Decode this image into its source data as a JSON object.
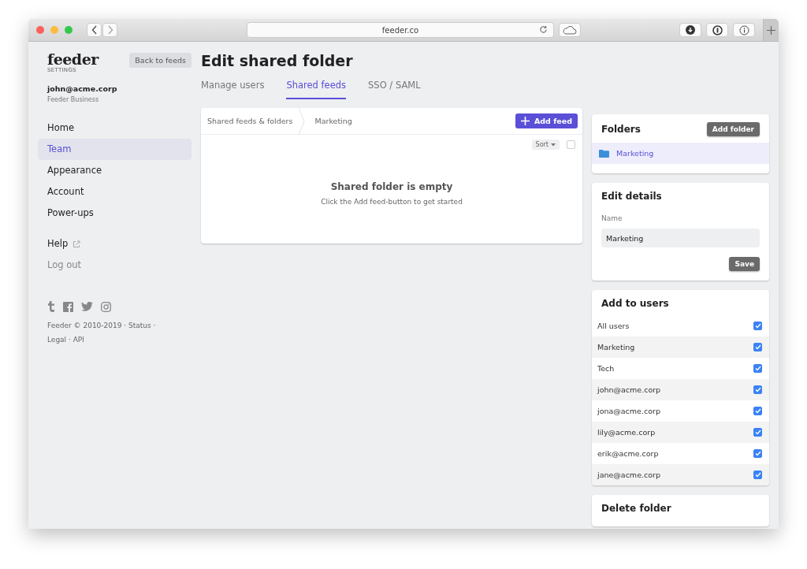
{
  "browser": {
    "url": "feeder.co"
  },
  "sidebar": {
    "logo": "feeder",
    "logo_sub": "SETTINGS",
    "back_button": "Back to feeds",
    "user_email": "john@acme.corp",
    "plan": "Feeder Business",
    "nav": [
      {
        "label": "Home",
        "selected": false
      },
      {
        "label": "Team",
        "selected": true
      },
      {
        "label": "Appearance",
        "selected": false
      },
      {
        "label": "Account",
        "selected": false
      },
      {
        "label": "Power-ups",
        "selected": false
      }
    ],
    "help": "Help",
    "logout": "Log out",
    "footer": "Feeder © 2010-2019 · Status · Legal · API"
  },
  "page_title": "Edit shared folder",
  "tabs": [
    {
      "label": "Manage users",
      "selected": false
    },
    {
      "label": "Shared feeds",
      "selected": true
    },
    {
      "label": "SSO / SAML",
      "selected": false
    }
  ],
  "feeds_panel": {
    "breadcrumbs": [
      "Shared feeds & folders",
      "Marketing"
    ],
    "add_button": "Add feed",
    "sort": "Sort",
    "select_all_checked": false,
    "empty_title": "Shared folder is empty",
    "empty_hint": "Click the Add feed-button to get started"
  },
  "folders": {
    "title": "Folders",
    "add_button": "Add folder",
    "items": [
      {
        "name": "Marketing",
        "selected": true
      }
    ]
  },
  "edit_details": {
    "title": "Edit details",
    "name_label": "Name",
    "name_value": "Marketing",
    "save_button": "Save"
  },
  "add_to_users": {
    "title": "Add to users",
    "rows": [
      {
        "label": "All users",
        "checked": true
      },
      {
        "label": "Marketing",
        "checked": true
      },
      {
        "label": "Tech",
        "checked": true
      },
      {
        "label": "john@acme.corp",
        "checked": true
      },
      {
        "label": "jona@acme.corp",
        "checked": true
      },
      {
        "label": "lily@acme.corp",
        "checked": true
      },
      {
        "label": "erik@acme.corp",
        "checked": true
      },
      {
        "label": "jane@acme.corp",
        "checked": true
      }
    ]
  },
  "delete_folder": {
    "title": "Delete folder"
  }
}
